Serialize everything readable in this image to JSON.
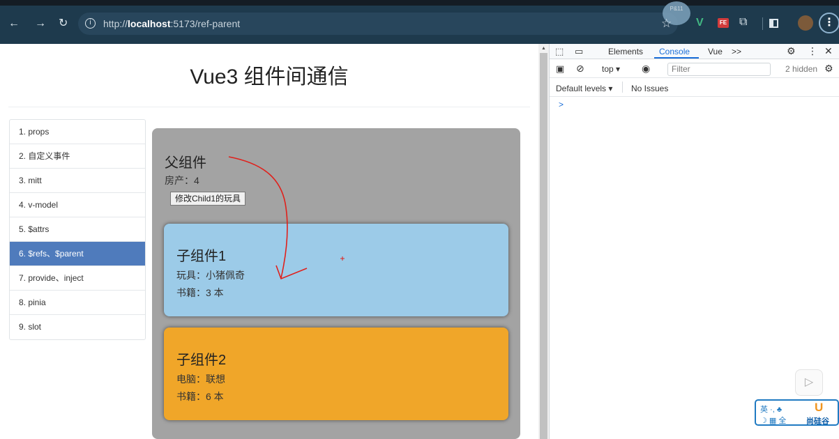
{
  "browser": {
    "url_prefix": "http://",
    "url_host": "localhost",
    "url_path": ":5173/ref-parent",
    "overlay_label": "P&11"
  },
  "page": {
    "title": "Vue3 组件间通信",
    "nav_items": [
      {
        "label": "1. props",
        "active": false
      },
      {
        "label": "2. 自定义事件",
        "active": false
      },
      {
        "label": "3. mitt",
        "active": false
      },
      {
        "label": "4. v-model",
        "active": false
      },
      {
        "label": "5. $attrs",
        "active": false
      },
      {
        "label": "6. $refs、$parent",
        "active": true
      },
      {
        "label": "7. provide、inject",
        "active": false
      },
      {
        "label": "8. pinia",
        "active": false
      },
      {
        "label": "9. slot",
        "active": false
      }
    ],
    "parent": {
      "title": "父组件",
      "house": "房产：4",
      "button_label": "修改Child1的玩具"
    },
    "child1": {
      "title": "子组件1",
      "toy": "玩具：小猪佩奇",
      "books": "书籍：3 本"
    },
    "child2": {
      "title": "子组件2",
      "computer": "电脑：联想",
      "books": "书籍：6 本"
    }
  },
  "devtools": {
    "tabs": [
      "Elements",
      "Console",
      "Vue"
    ],
    "active_tab": "Console",
    "more_tabs": ">>",
    "context": "top",
    "filter_placeholder": "Filter",
    "hidden_count": "2 hidden",
    "default_levels": "Default levels",
    "issues": "No Issues",
    "prompt": ">"
  },
  "overlays": {
    "ime_line1": "英 ·, ♣",
    "ime_line2": "☽ ▦ 全",
    "brand": "尚硅谷"
  },
  "colors": {
    "browser_bar": "#1e3a4d",
    "nav_active": "#4f7bbc",
    "parent_bg": "#a3a3a3",
    "child1_bg": "#9ccbe8",
    "child2_bg": "#f0a629",
    "annotation": "#e0201b"
  }
}
